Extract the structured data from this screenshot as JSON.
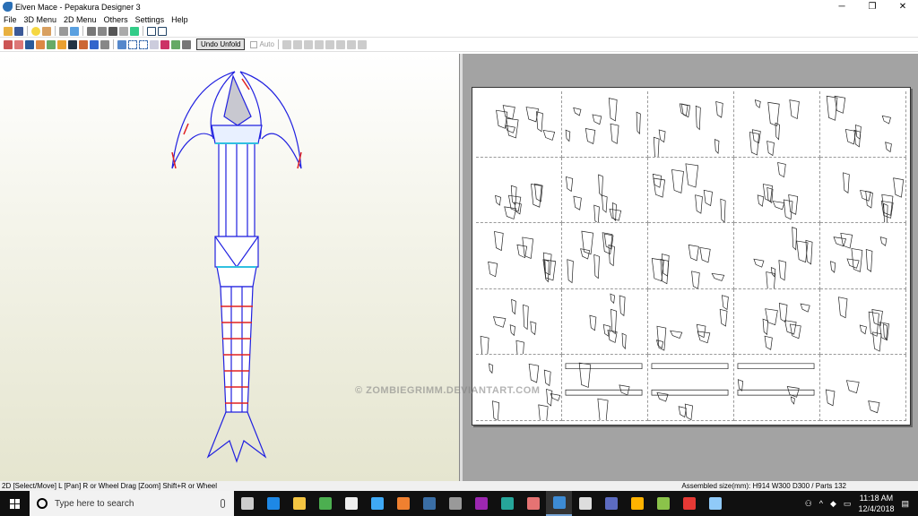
{
  "window": {
    "title": "Elven Mace - Pepakura Designer 3",
    "minimize": "─",
    "maximize": "❐",
    "close": "✕"
  },
  "menu": [
    "File",
    "3D Menu",
    "2D Menu",
    "Others",
    "Settings",
    "Help"
  ],
  "toolbar": {
    "undo_unfold": "Undo Unfold",
    "auto": "Auto"
  },
  "watermark": "© ZOMBIEGRIMM.DEVIANTART.COM",
  "status": {
    "left": "2D [Select/Move] L [Pan] R or Wheel Drag [Zoom] Shift+R or Wheel",
    "right": "Assembled size(mm): H914 W300 D300 / Parts 132"
  },
  "taskbar": {
    "search_placeholder": "Type here to search",
    "time": "11:18 AM",
    "date": "12/4/2018",
    "apps": [
      {
        "name": "task-view",
        "color": "#cccccc"
      },
      {
        "name": "edge",
        "color": "#1e88e5"
      },
      {
        "name": "file-explorer",
        "color": "#f4c542"
      },
      {
        "name": "green-app",
        "color": "#4caf50"
      },
      {
        "name": "store",
        "color": "#eeeeee"
      },
      {
        "name": "internet-explorer",
        "color": "#3fa9f5"
      },
      {
        "name": "media-app",
        "color": "#f08030"
      },
      {
        "name": "hp-app",
        "color": "#3a6ea5"
      },
      {
        "name": "app-9",
        "color": "#999999"
      },
      {
        "name": "app-10",
        "color": "#9c27b0"
      },
      {
        "name": "app-11",
        "color": "#26a69a"
      },
      {
        "name": "app-12",
        "color": "#e57373"
      },
      {
        "name": "pepakura",
        "color": "#3d8bd4",
        "active": true
      },
      {
        "name": "calculator",
        "color": "#dddddd"
      },
      {
        "name": "app-15",
        "color": "#5c6bc0"
      },
      {
        "name": "app-16",
        "color": "#ffb300"
      },
      {
        "name": "app-17",
        "color": "#8bc34a"
      },
      {
        "name": "chrome",
        "color": "#e53935"
      },
      {
        "name": "paint",
        "color": "#90caf9"
      }
    ]
  }
}
